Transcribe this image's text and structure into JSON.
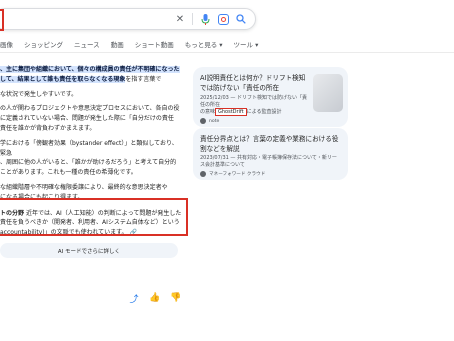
{
  "search": {
    "placeholder": ""
  },
  "tabs": [
    "画像",
    "ショッピング",
    "ニュース",
    "動画",
    "ショート動画",
    "もっと見る ▾",
    "ツール ▾"
  ],
  "answer": {
    "p1a": "、主に集団や組織において、個々の構成員の責任が不明確になった",
    "p1b": "して、結果として誰も責任を取らなくなる現象",
    "p1c": "を指す言葉で",
    "p2": "な状況で発生しやすいです。",
    "p3a": "の人が関わるプロジェクトや意思決定プロセスにおいて、各自の役",
    "p3b": "に定義されていない場合、問題が発生した際に「自分だけの責任",
    "p3c": "責任を誰かが背負わずかまえます。",
    "p4a": "学における「傍観者効果（bystander effect）」と類似しており、緊急",
    "p4b": "、周囲に他の人がいると、「誰かが助けるだろう」と考えて自分的",
    "p4c": "ことがあります。これも一種の責任の希薄化です。",
    "p5a": "な組織階層や不明確な権限委譲により、最終的な意思決定者や",
    "p5b": "になる場合にも起こり得ます。",
    "box1_label": "トの分野",
    "box1_text": "近年では、AI（人工知能）の判断によって問題が発生した",
    "box1_line2": "責任を負うべきか（開発者、利用者、AIシステム自体など）という",
    "box1_line3": "accountability)」の文脈でも使われています。",
    "ai_mode_label": "AI モードでさらに詳しく"
  },
  "cards": [
    {
      "title": "AI説明責任とは何か？ドリフト検知では防げない「責任の所在",
      "snippet": "2025/12/03 — ドリフト検知では防げない「責任の所在",
      "snippet_pre": "の意味",
      "highlight": "GhostDrift",
      "snippet_post": "による監査設計",
      "source": "note"
    },
    {
      "title": "責任分界点とは？言葉の定義や業務における役割などを解説",
      "snippet": "2023/07/31 — 共有対応・電子帳簿保存法について・新リース会計基準について",
      "source": "マネーフォワード クラウド"
    }
  ]
}
